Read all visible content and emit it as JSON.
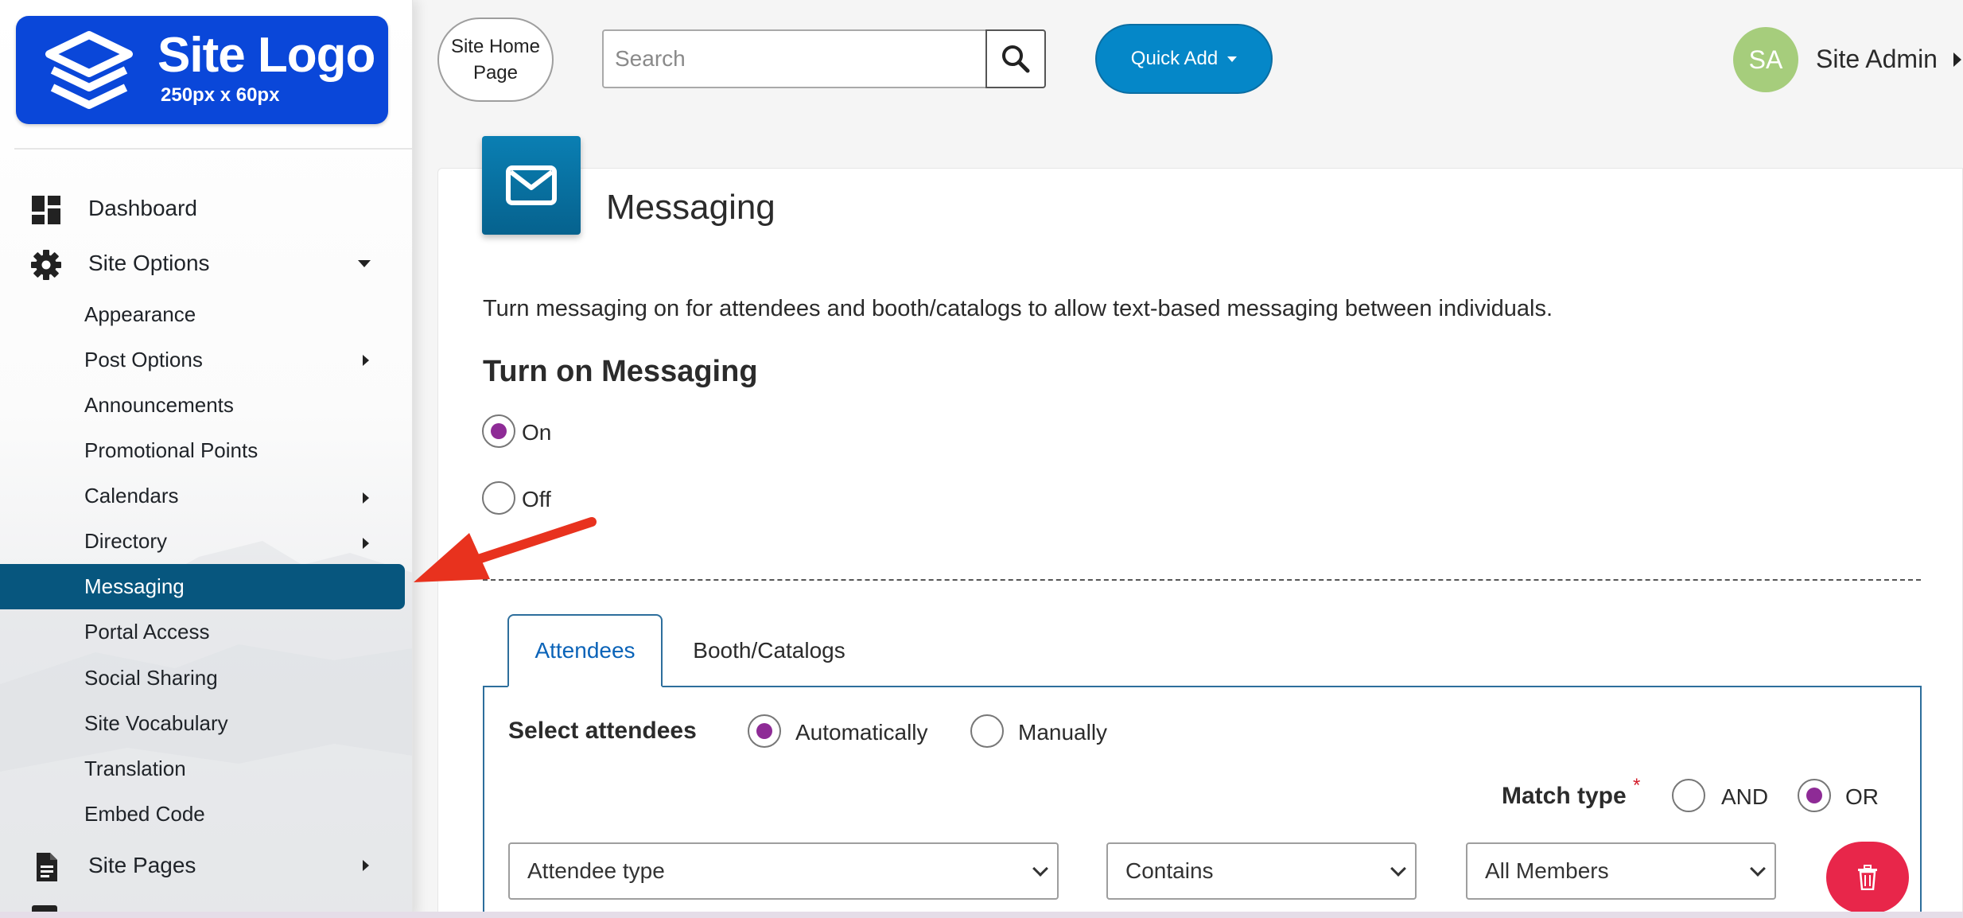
{
  "logo": {
    "title": "Site Logo",
    "subtitle": "250px x 60px",
    "color": "#0a47d9"
  },
  "sidebar": {
    "top_items": [
      {
        "label": "Dashboard",
        "icon": "dashboard-icon"
      },
      {
        "label": "Site Options",
        "icon": "gear-icon",
        "expanded": true
      }
    ],
    "sub_items": [
      {
        "label": "Appearance"
      },
      {
        "label": "Post Options",
        "has_children": true
      },
      {
        "label": "Announcements"
      },
      {
        "label": "Promotional Points"
      },
      {
        "label": "Calendars",
        "has_children": true
      },
      {
        "label": "Directory",
        "has_children": true
      },
      {
        "label": "Messaging",
        "active": true
      },
      {
        "label": "Portal Access"
      },
      {
        "label": "Social Sharing"
      },
      {
        "label": "Site Vocabulary"
      },
      {
        "label": "Translation"
      },
      {
        "label": "Embed Code"
      }
    ],
    "bottom_items": [
      {
        "label": "Site Pages",
        "icon": "document-icon",
        "has_children": true
      }
    ],
    "active_color": "#07567e"
  },
  "topbar": {
    "home_button": "Site Home\nPage",
    "search_placeholder": "Search",
    "quick_add": "Quick Add",
    "user_initials": "SA",
    "user_name": "Site Admin",
    "accent": "#0587c8"
  },
  "page": {
    "title": "Messaging",
    "intro": "Turn messaging on for attendees and booth/catalogs to allow text-based messaging between individuals.",
    "section_heading": "Turn on Messaging",
    "messaging_options": [
      {
        "label": "On",
        "checked": true
      },
      {
        "label": "Off",
        "checked": false
      }
    ],
    "tabs": [
      {
        "label": "Attendees",
        "active": true
      },
      {
        "label": "Booth/Catalogs",
        "active": false
      }
    ],
    "select_attendees": {
      "label": "Select attendees",
      "options": [
        {
          "label": "Automatically",
          "checked": true
        },
        {
          "label": "Manually",
          "checked": false
        }
      ]
    },
    "match_type": {
      "label": "Match type",
      "required_mark": "*",
      "options": [
        {
          "label": "AND",
          "checked": false
        },
        {
          "label": "OR",
          "checked": true
        }
      ]
    },
    "filter_row": {
      "field": "Attendee type",
      "operator": "Contains",
      "value": "All Members"
    },
    "radio_color": "#8e2b96",
    "delete_color": "#e8264a"
  }
}
